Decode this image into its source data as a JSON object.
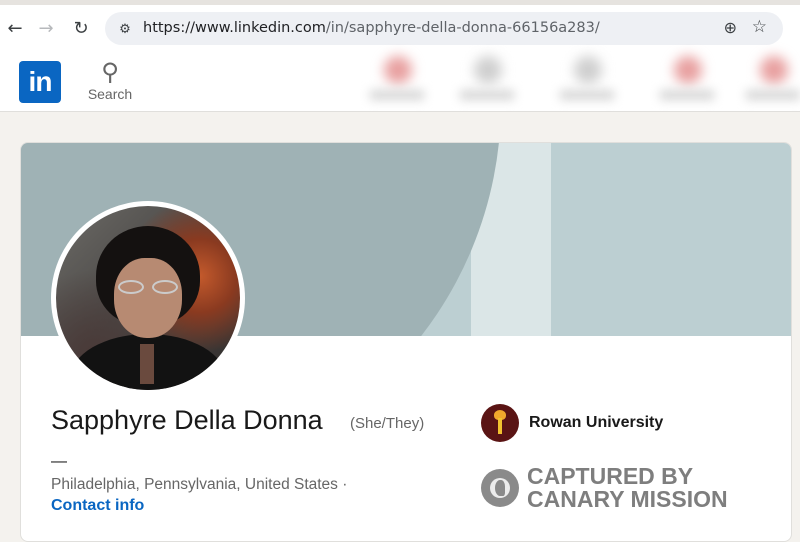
{
  "browser": {
    "back_icon": "arrow-left-icon",
    "forward_icon": "arrow-right-icon",
    "reload_icon": "reload-icon",
    "url_host": "https://www.linkedin.com",
    "url_path": "/in/sapphyre-della-donna-66156a283/",
    "zoom_icon": "zoom-icon",
    "bookmark_icon": "star-icon"
  },
  "header": {
    "logo_text": "in",
    "search_label": "Search",
    "brand_color": "#0a66c2"
  },
  "profile": {
    "name": "Sapphyre Della Donna",
    "pronouns": "(She/They)",
    "headline": "—",
    "location": "Philadelphia, Pennsylvania, United States ·",
    "contact_link": "Contact info",
    "education": "Rowan University"
  },
  "watermark": {
    "line1": "CAPTURED BY",
    "line2": "CANARY MISSION"
  }
}
